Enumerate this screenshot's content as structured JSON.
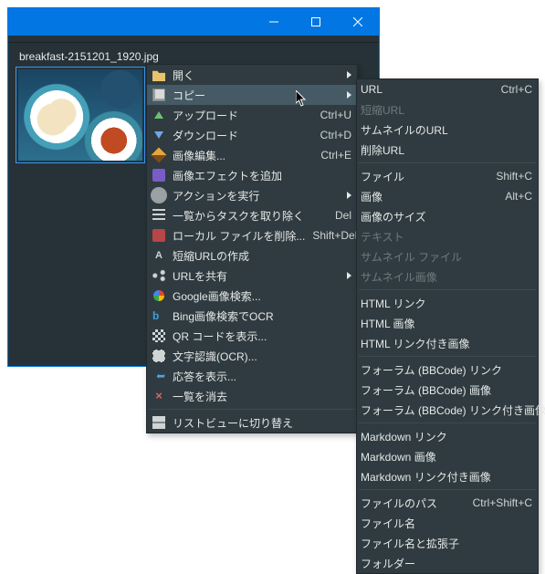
{
  "file": {
    "name": "breakfast-2151201_1920.jpg"
  },
  "menu1": {
    "open": {
      "label": "開く"
    },
    "copy": {
      "label": "コピー"
    },
    "upload": {
      "label": "アップロード",
      "key": "Ctrl+U"
    },
    "download": {
      "label": "ダウンロード",
      "key": "Ctrl+D"
    },
    "edit": {
      "label": "画像編集...",
      "key": "Ctrl+E"
    },
    "effects": {
      "label": "画像エフェクトを追加"
    },
    "actions": {
      "label": "アクションを実行"
    },
    "removeTask": {
      "label": "一覧からタスクを取り除く",
      "key": "Del"
    },
    "delLocal": {
      "label": "ローカル ファイルを削除...",
      "key": "Shift+Del"
    },
    "shortUrl": {
      "label": "短縮URLの作成"
    },
    "shareUrl": {
      "label": "URLを共有"
    },
    "gsearch": {
      "label": "Google画像検索..."
    },
    "bingOcr": {
      "label": "Bing画像検索でOCR"
    },
    "qrcode": {
      "label": "QR コードを表示..."
    },
    "ocr": {
      "label": "文字認識(OCR)..."
    },
    "response": {
      "label": "応答を表示..."
    },
    "clear": {
      "label": "一覧を消去"
    },
    "listview": {
      "label": "リストビューに切り替え"
    }
  },
  "menu2": {
    "url": {
      "label": "URL",
      "key": "Ctrl+C"
    },
    "shortUrl": {
      "label": "短縮URL"
    },
    "thumbUrl": {
      "label": "サムネイルのURL"
    },
    "delUrl": {
      "label": "削除URL"
    },
    "file": {
      "label": "ファイル",
      "key": "Shift+C"
    },
    "image": {
      "label": "画像",
      "key": "Alt+C"
    },
    "imageSize": {
      "label": "画像のサイズ"
    },
    "text": {
      "label": "テキスト"
    },
    "thumbFile": {
      "label": "サムネイル ファイル"
    },
    "thumbImage": {
      "label": "サムネイル画像"
    },
    "htmlLink": {
      "label": "HTML リンク"
    },
    "htmlImage": {
      "label": "HTML 画像"
    },
    "htmlLinked": {
      "label": "HTML リンク付き画像"
    },
    "bbLink": {
      "label": "フォーラム (BBCode) リンク"
    },
    "bbImage": {
      "label": "フォーラム (BBCode) 画像"
    },
    "bbLinked": {
      "label": "フォーラム (BBCode) リンク付き画像"
    },
    "mdLink": {
      "label": "Markdown リンク"
    },
    "mdImage": {
      "label": "Markdown 画像"
    },
    "mdLinked": {
      "label": "Markdown リンク付き画像"
    },
    "filePath": {
      "label": "ファイルのパス",
      "key": "Ctrl+Shift+C"
    },
    "fileName": {
      "label": "ファイル名"
    },
    "fileNameExt": {
      "label": "ファイル名と拡張子"
    },
    "folder": {
      "label": "フォルダー"
    }
  }
}
